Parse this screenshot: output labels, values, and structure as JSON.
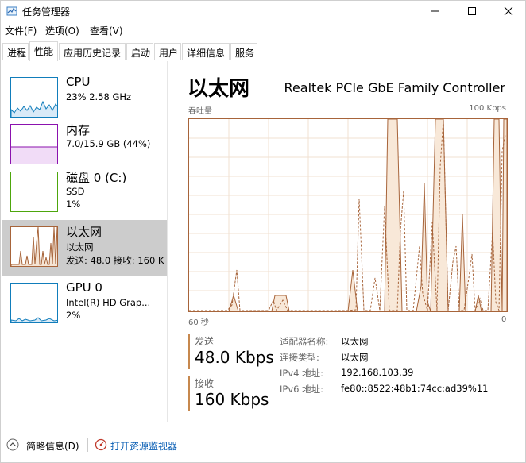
{
  "window": {
    "title": "任务管理器"
  },
  "menu": [
    "文件(F)",
    "选项(O)",
    "查看(V)"
  ],
  "tabs": [
    "进程",
    "性能",
    "应用历史记录",
    "启动",
    "用户",
    "详细信息",
    "服务"
  ],
  "active_tab": "性能",
  "sidebar": {
    "items": [
      {
        "title": "CPU",
        "sub1": "23%  2.58 GHz",
        "sub2": "",
        "color": "#117dbb"
      },
      {
        "title": "内存",
        "sub1": "7.0/15.9 GB (44%)",
        "sub2": "",
        "color": "#8b12ae"
      },
      {
        "title": "磁盘 0 (C:)",
        "sub1": "SSD",
        "sub2": "1%",
        "color": "#4da60c"
      },
      {
        "title": "以太网",
        "sub1": "以太网",
        "sub2": "发送: 48.0  接收: 160 K",
        "color": "#a7643a"
      },
      {
        "title": "GPU 0",
        "sub1": "Intel(R) HD Grap...",
        "sub2": "2%",
        "color": "#117dbb"
      }
    ]
  },
  "main": {
    "title": "以太网",
    "adapter": "Realtek PCIe GbE Family Controller",
    "graph_label_left": "吞吐量",
    "graph_label_right": "100 Kbps",
    "time_left": "60 秒",
    "time_right": "0",
    "send_label": "发送",
    "send_value": "48.0 Kbps",
    "recv_label": "接收",
    "recv_value": "160 Kbps",
    "info": [
      {
        "label": "适配器名称:",
        "value": "以太网"
      },
      {
        "label": "连接类型:",
        "value": "以太网"
      },
      {
        "label": "IPv4 地址:",
        "value": "192.168.103.39"
      },
      {
        "label": "IPv6 地址:",
        "value": "fe80::8522:48b1:74cc:ad39%11"
      }
    ]
  },
  "footer": {
    "brief_label": "简略信息(D)",
    "monitor_label": "打开资源监视器"
  }
}
